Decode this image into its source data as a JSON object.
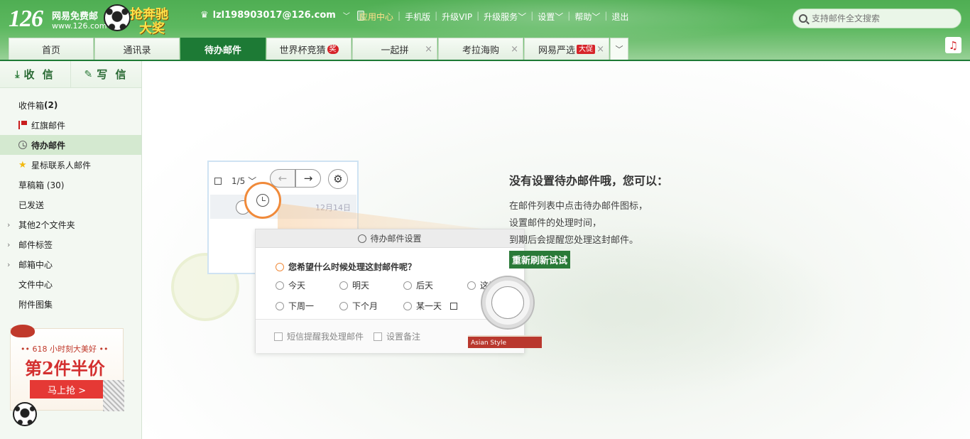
{
  "brand": {
    "logo_number": "126",
    "logo_title": "网易免费邮",
    "logo_url": "www.126.com",
    "promo_line1": "抢奔驰",
    "promo_line2": "大奖"
  },
  "account": {
    "email": "lzl198903017@126.com"
  },
  "topnav": {
    "items": [
      "应用中心",
      "手机版",
      "升级VIP",
      "升级服务",
      "设置",
      "帮助",
      "退出"
    ]
  },
  "search": {
    "placeholder": "支持邮件全文搜索"
  },
  "tabs": [
    {
      "label": "首页"
    },
    {
      "label": "通讯录"
    },
    {
      "label": "待办邮件"
    },
    {
      "label": "世界杯竞猜",
      "badge": "奖"
    },
    {
      "label": "一起拼"
    },
    {
      "label": "考拉海购"
    },
    {
      "label": "网易严选",
      "badge": "大促"
    }
  ],
  "sidebar": {
    "receive_label": "收 信",
    "compose_label": "写 信",
    "items": [
      {
        "label": "收件箱 ",
        "count": "(2)"
      },
      {
        "label": "红旗邮件"
      },
      {
        "label": "待办邮件"
      },
      {
        "label": "星标联系人邮件"
      },
      {
        "label": "草稿箱 (30)"
      },
      {
        "label": "已发送"
      },
      {
        "label": "其他2个文件夹"
      },
      {
        "label": "邮件标签"
      },
      {
        "label": "邮箱中心"
      },
      {
        "label": "文件中心"
      },
      {
        "label": "附件图集"
      }
    ],
    "ad": {
      "line1": "•• 618 小时刻大美好 ••",
      "line2": "第2件半价",
      "button": "马上抢 >"
    }
  },
  "illustration": {
    "pager": "1/5",
    "date": "12月14日",
    "dialog_title": "待办邮件设置",
    "question": "您希望什么时候处理这封邮件呢？",
    "options": [
      "今天",
      "明天",
      "后天",
      "这周末",
      "下周一",
      "下个月",
      "某一天"
    ],
    "sms_reminder": "短信提醒我处理邮件",
    "set_note": "设置备注",
    "book_text": "Asian Style"
  },
  "hint": {
    "title": "没有设置待办邮件哦，您可以：",
    "lines": [
      "在邮件列表中点击待办邮件图标，",
      "设置邮件的处理时间，",
      "到期后会提醒您处理这封邮件。"
    ],
    "refresh_button": "重新刷新试试"
  },
  "colors": {
    "brand_green": "#5cb85f",
    "active_tab": "#1d7a35",
    "accent_orange": "#f08a3a",
    "badge_red": "#d6242a"
  }
}
